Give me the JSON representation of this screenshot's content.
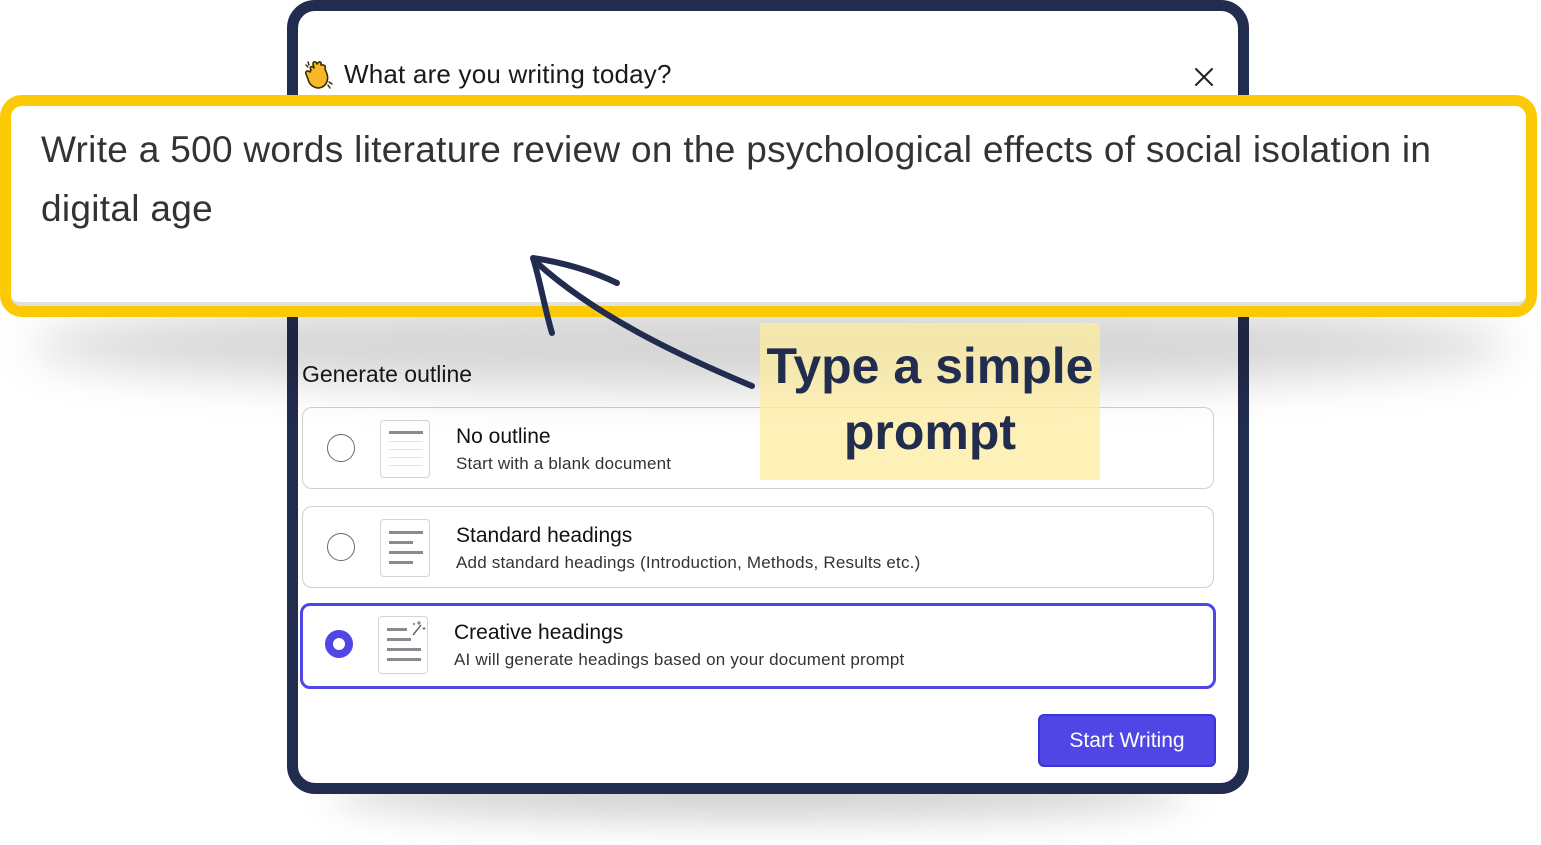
{
  "modal": {
    "title": "What are you writing today?",
    "outline_label": "Generate outline",
    "options": [
      {
        "title": "No outline",
        "description": "Start with a blank document",
        "selected": false
      },
      {
        "title": "Standard headings",
        "description": "Add standard headings (Introduction, Methods, Results etc.)",
        "selected": false
      },
      {
        "title": "Creative headings",
        "description": "AI will generate headings based on your document prompt",
        "selected": true
      }
    ],
    "start_button": "Start Writing"
  },
  "prompt": {
    "text": "Write a 500 words literature review on the psychological effects of social isolation in digital age"
  },
  "annotation": {
    "text": "Type a simple prompt"
  },
  "colors": {
    "accent": "#4f46e5",
    "frame": "#222c4e",
    "highlight_border": "#fcca05",
    "annotation_bg": "#fdeca0"
  },
  "icons": {
    "header": "waving-hand-icon",
    "close": "close-icon",
    "doc_blank": "blank-document-icon",
    "doc_lines": "document-lines-icon",
    "doc_magic": "document-sparkle-icon",
    "arrow": "curved-arrow-icon"
  }
}
